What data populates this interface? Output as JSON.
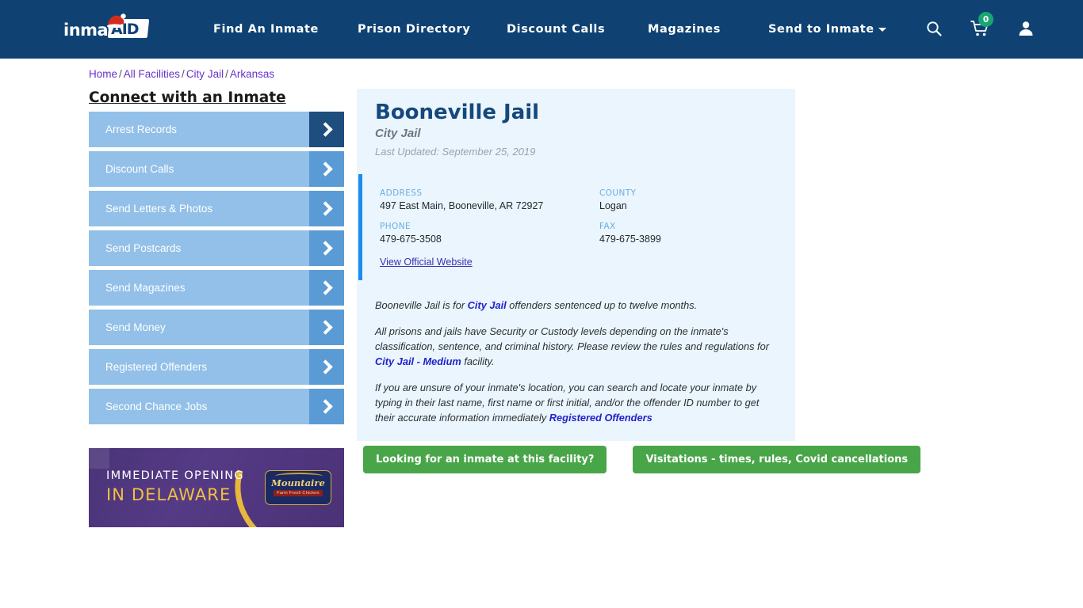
{
  "header": {
    "logo_text": "inmate",
    "logo_badge": "AID",
    "logo_hat_icon": "santa-hat-icon",
    "nav": [
      {
        "label": "Find An Inmate"
      },
      {
        "label": "Prison Directory"
      },
      {
        "label": "Discount Calls"
      },
      {
        "label": "Magazines"
      },
      {
        "label": "Send to Inmate",
        "has_caret": true
      }
    ],
    "icons": {
      "search": "search-icon",
      "cart": "shopping-cart-icon",
      "cart_count": "0",
      "account": "user-account-icon"
    },
    "bg_color": "#0f4273",
    "badge_color": "#17a673"
  },
  "breadcrumb": {
    "items": [
      "Home",
      "All Facilities",
      "City Jail",
      "Arkansas"
    ],
    "separator": "/",
    "link_color": "#6633cc"
  },
  "sidebar": {
    "title": "Connect with an Inmate",
    "items": [
      {
        "label": "Arrest Records",
        "active": true
      },
      {
        "label": "Discount Calls",
        "active": false
      },
      {
        "label": "Send Letters & Photos",
        "active": false
      },
      {
        "label": "Send Postcards",
        "active": false
      },
      {
        "label": "Send Magazines",
        "active": false
      },
      {
        "label": "Send Money",
        "active": false
      },
      {
        "label": "Registered Offenders",
        "active": false
      },
      {
        "label": "Second Chance Jobs",
        "active": false
      }
    ],
    "item_bg": "#92c0e8",
    "chevron_bg": "#5b9bd5",
    "chevron_active_bg": "#1d4e7e"
  },
  "ad": {
    "line1": "IMMEDIATE OPENING",
    "line2": "IN DELAWARE",
    "brand": "Mountaire",
    "brand_sub": "Farm Fresh Chicken",
    "bg_color": "#4b3276",
    "accent_color": "#f0c040"
  },
  "facility": {
    "title": "Booneville Jail",
    "subtitle": "City Jail",
    "last_updated": "Last Updated: September 25, 2019",
    "fields": [
      {
        "label": "ADDRESS",
        "value": "497 East Main, Booneville, AR 72927"
      },
      {
        "label": "COUNTY",
        "value": "Logan"
      },
      {
        "label": "PHONE",
        "value": "479-675-3508"
      },
      {
        "label": "FAX",
        "value": "479-675-3899"
      }
    ],
    "official_website_link": "View Official Website",
    "accent_bar_color": "#1a8cf0",
    "panel_bg": "#eaf5fd",
    "title_color": "#16487d",
    "description": {
      "p1_a": "Booneville Jail is for ",
      "p1_link": "City Jail",
      "p1_b": " offenders sentenced up to twelve months.",
      "p2_a": "All prisons and jails have Security or Custody levels depending on the inmate's classification, sentence, and criminal history. Please review the rules and regulations for ",
      "p2_link": "City Jail - Medium",
      "p2_b": " facility.",
      "p3_a": "If you are unsure of your inmate's location, you can search and locate your inmate by typing in their last name, first name or first initial, and/or the offender ID number to get their accurate information immediately ",
      "p3_link": "Registered Offenders"
    }
  },
  "cta": {
    "buttons": [
      {
        "label": "Looking for an inmate at this facility?"
      },
      {
        "label": "Visitations - times, rules, Covid cancellations"
      }
    ],
    "color": "#48a548"
  }
}
